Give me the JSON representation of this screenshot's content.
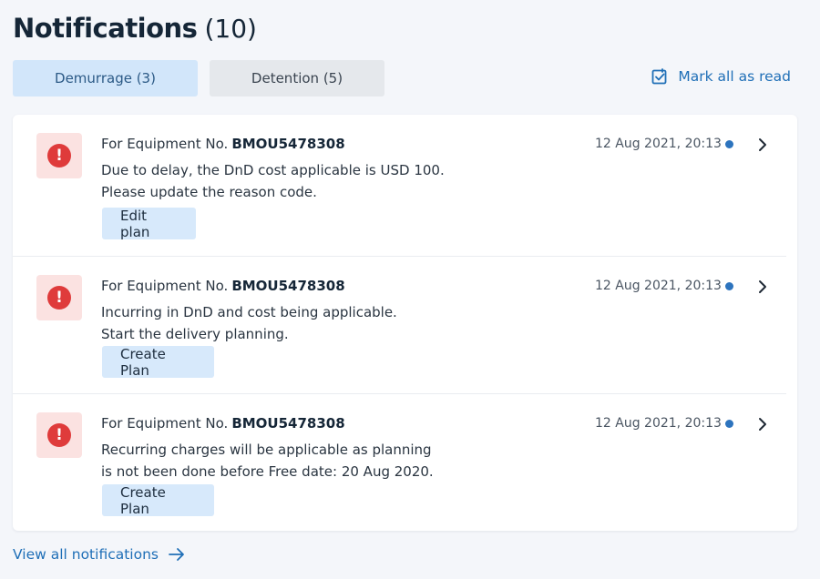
{
  "header": {
    "title": "Notifications",
    "count": "(10)"
  },
  "tabs": [
    {
      "label": "Demurrage (3)",
      "active": true
    },
    {
      "label": "Detention (5)",
      "active": false
    }
  ],
  "mark_all_label": "Mark all as read",
  "notifications": [
    {
      "prefix": "For Equipment No.",
      "equipment": "BMOU5478308",
      "line1": "Due to delay, the DnD cost applicable is USD 100.",
      "line2": "Please update the reason code.",
      "button": "Edit plan",
      "time": "12 Aug 2021, 20:13"
    },
    {
      "prefix": "For Equipment No.",
      "equipment": "BMOU5478308",
      "line1": "Incurring in DnD and cost being applicable.",
      "line2": "Start the delivery planning.",
      "button": "Create Plan",
      "time": "12 Aug 2021, 20:13"
    },
    {
      "prefix": "For Equipment No.",
      "equipment": "BMOU5478308",
      "line1": "Recurring charges will be applicable as planning",
      "line2": "is not been done before Free date: 20 Aug 2020.",
      "button": "Create Plan",
      "time": "12 Aug 2021, 20:13"
    }
  ],
  "view_all_label": "View all notifications",
  "colors": {
    "accent": "#1f6fb7",
    "alert": "#df3b3b",
    "alert_bg": "#fbe2e1",
    "unread": "#2d74be",
    "tab_active_bg": "#d2e6fa"
  },
  "icons": {
    "alert": "exclamation-circle-icon",
    "mark_all": "checkbox-icon",
    "chevron": "chevron-right-icon",
    "view_all": "arrow-right-icon"
  }
}
